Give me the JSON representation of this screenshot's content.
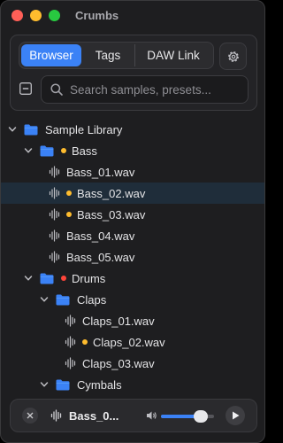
{
  "window": {
    "title": "Crumbs"
  },
  "tabs": [
    {
      "label": "Browser",
      "active": true
    },
    {
      "label": "Tags",
      "active": false
    },
    {
      "label": "DAW Link",
      "active": false
    }
  ],
  "search": {
    "placeholder": "Search samples, presets..."
  },
  "colors": {
    "accent": "#3b82f6",
    "tag_yellow": "#febc2e",
    "tag_red": "#ff453a"
  },
  "tree": [
    {
      "type": "folder",
      "label": "Sample Library",
      "depth": 0,
      "expanded": true,
      "tag": null
    },
    {
      "type": "folder",
      "label": "Bass",
      "depth": 1,
      "expanded": true,
      "tag": "yellow"
    },
    {
      "type": "file",
      "label": "Bass_01.wav",
      "depth": 2,
      "tag": null
    },
    {
      "type": "file",
      "label": "Bass_02.wav",
      "depth": 2,
      "tag": "yellow",
      "selected": true
    },
    {
      "type": "file",
      "label": "Bass_03.wav",
      "depth": 2,
      "tag": "yellow"
    },
    {
      "type": "file",
      "label": "Bass_04.wav",
      "depth": 2,
      "tag": null
    },
    {
      "type": "file",
      "label": "Bass_05.wav",
      "depth": 2,
      "tag": null
    },
    {
      "type": "folder",
      "label": "Drums",
      "depth": 1,
      "expanded": true,
      "tag": "red"
    },
    {
      "type": "folder",
      "label": "Claps",
      "depth": 2,
      "expanded": true,
      "tag": null
    },
    {
      "type": "file",
      "label": "Claps_01.wav",
      "depth": 3,
      "tag": null
    },
    {
      "type": "file",
      "label": "Claps_02.wav",
      "depth": 3,
      "tag": "yellow"
    },
    {
      "type": "file",
      "label": "Claps_03.wav",
      "depth": 3,
      "tag": null
    },
    {
      "type": "folder",
      "label": "Cymbals",
      "depth": 2,
      "expanded": true,
      "tag": null
    }
  ],
  "player": {
    "track_name": "Bass_0...",
    "volume": 0.75
  }
}
